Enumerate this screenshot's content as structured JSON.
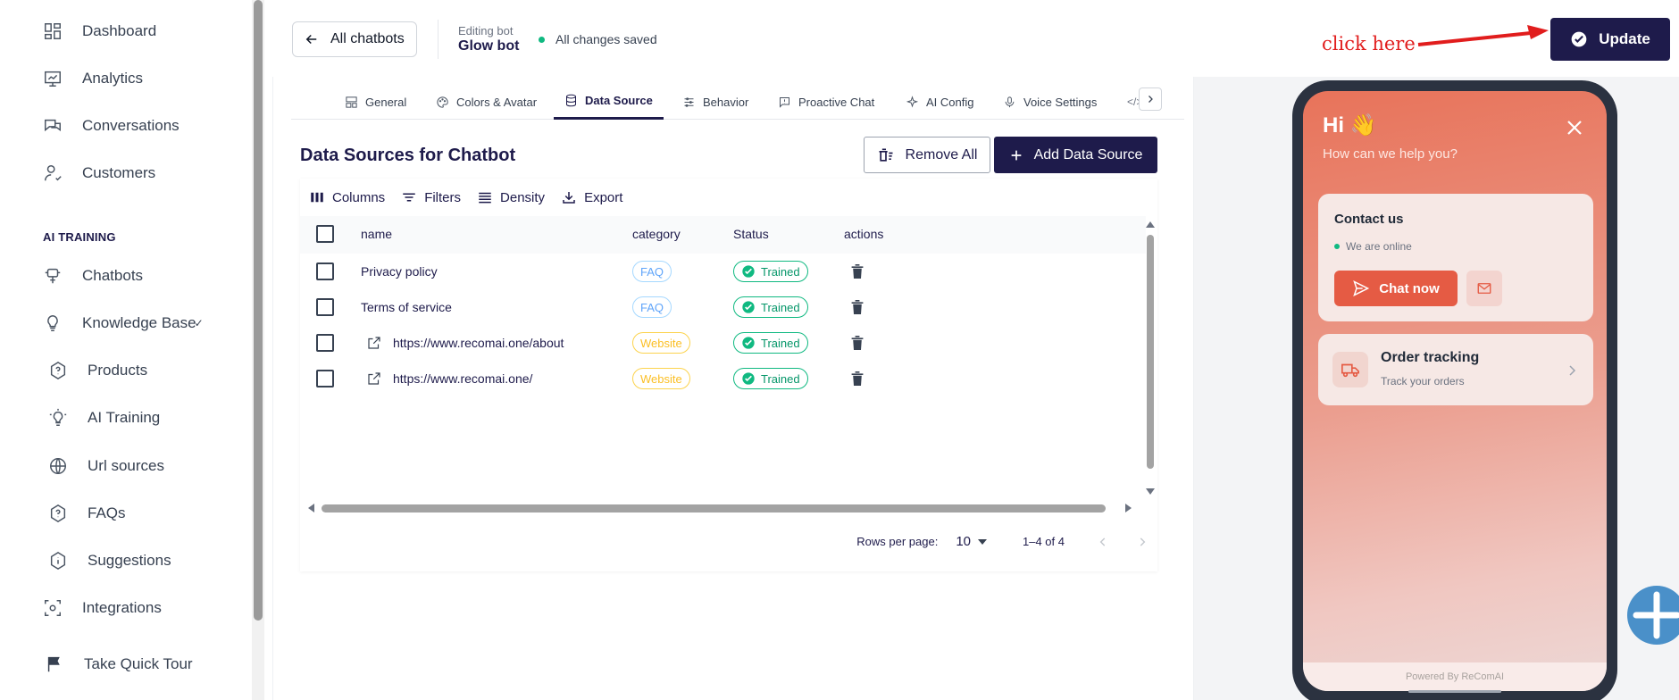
{
  "sidebar": {
    "items": [
      {
        "label": "Dashboard",
        "icon": "dashboard-icon"
      },
      {
        "label": "Analytics",
        "icon": "analytics-icon"
      },
      {
        "label": "Conversations",
        "icon": "conversations-icon"
      },
      {
        "label": "Customers",
        "icon": "customers-icon"
      }
    ],
    "section_title": "AI TRAINING",
    "training_items": [
      {
        "label": "Chatbots",
        "icon": "chatbot-icon"
      },
      {
        "label": "Knowledge Base",
        "icon": "lightbulb-icon"
      },
      {
        "label": "Products",
        "icon": "hexagon-help-icon"
      },
      {
        "label": "AI Training",
        "icon": "lightbulb-icon"
      },
      {
        "label": "Url sources",
        "icon": "globe-icon"
      },
      {
        "label": "FAQs",
        "icon": "hexagon-help-icon"
      },
      {
        "label": "Suggestions",
        "icon": "info-icon"
      },
      {
        "label": "Integrations",
        "icon": "integrations-icon"
      }
    ],
    "tour_label": "Take Quick Tour"
  },
  "topbar": {
    "back_label": "All chatbots",
    "editing_label": "Editing bot",
    "bot_name": "Glow bot",
    "saved_status": "All changes saved",
    "annotation": "click here",
    "update_label": "Update",
    "status_color": "#10b981",
    "accent_color": "#1e1b4b"
  },
  "tabs": [
    {
      "label": "General",
      "icon": "layout-icon"
    },
    {
      "label": "Colors & Avatar",
      "icon": "palette-icon"
    },
    {
      "label": "Data Source",
      "icon": "database-icon",
      "active": true
    },
    {
      "label": "Behavior",
      "icon": "sliders-icon"
    },
    {
      "label": "Proactive Chat",
      "icon": "message-icon"
    },
    {
      "label": "AI Config",
      "icon": "sparkle-icon"
    },
    {
      "label": "Voice Settings",
      "icon": "mic-icon"
    }
  ],
  "data_source": {
    "title": "Data Sources for Chatbot",
    "remove_all_label": "Remove All",
    "add_label": "Add Data Source",
    "toolbar": {
      "columns": "Columns",
      "filters": "Filters",
      "density": "Density",
      "export": "Export"
    },
    "columns": {
      "name": "name",
      "category": "category",
      "status": "Status",
      "actions": "actions"
    },
    "rows": [
      {
        "name": "Privacy policy",
        "category": "FAQ",
        "status": "Trained",
        "link": false
      },
      {
        "name": "Terms of service",
        "category": "FAQ",
        "status": "Trained",
        "link": false
      },
      {
        "name": "https://www.recomai.one/about",
        "category": "Website",
        "status": "Trained",
        "link": true
      },
      {
        "name": "https://www.recomai.one/",
        "category": "Website",
        "status": "Trained",
        "link": true
      }
    ],
    "rows_per_page_label": "Rows per page:",
    "rows_per_page": "10",
    "range": "1–4 of 4"
  },
  "preview": {
    "greeting": "Hi 👋",
    "help": "How can we help you?",
    "contact_title": "Contact us",
    "online": "We are online",
    "chat_now": "Chat now",
    "order_title": "Order tracking",
    "order_sub": "Track your orders",
    "powered_by": "Powered By ReComAI",
    "brand_color": "#e55b44"
  }
}
